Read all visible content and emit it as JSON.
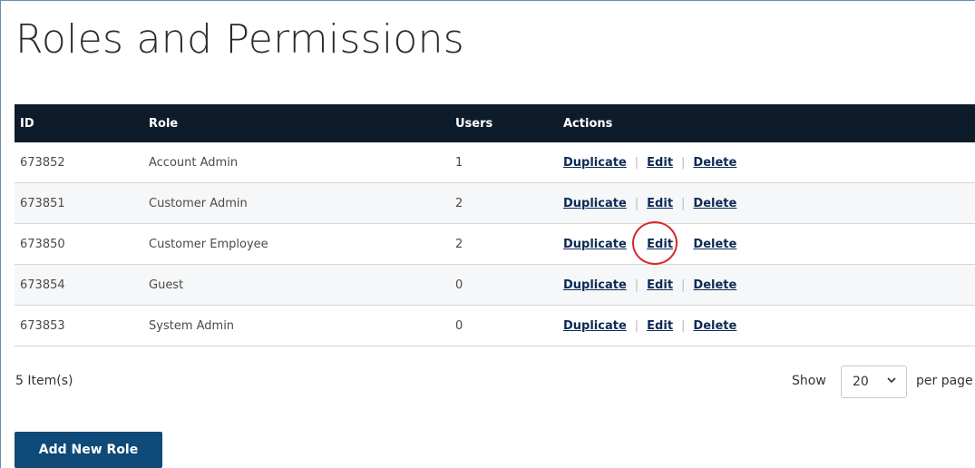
{
  "page": {
    "title": "Roles and Permissions"
  },
  "table": {
    "headers": {
      "id": "ID",
      "role": "Role",
      "users": "Users",
      "actions": "Actions"
    },
    "rows": [
      {
        "id": "673852",
        "role": "Account Admin",
        "users": "1"
      },
      {
        "id": "673851",
        "role": "Customer Admin",
        "users": "2"
      },
      {
        "id": "673850",
        "role": "Customer Employee",
        "users": "2"
      },
      {
        "id": "673854",
        "role": "Guest",
        "users": "0"
      },
      {
        "id": "673853",
        "role": "System Admin",
        "users": "0"
      }
    ],
    "actions": {
      "duplicate": "Duplicate",
      "edit": "Edit",
      "delete": "Delete",
      "separator": "|"
    }
  },
  "footer": {
    "item_count": "5 Item(s)",
    "show_label": "Show",
    "per_page_value": "20",
    "per_page_label": "per page",
    "add_button": "Add New Role"
  },
  "colors": {
    "header_bg": "#0e1b2b",
    "button_bg": "#0f4a78",
    "link": "#0d2a55",
    "highlight_circle": "#d8262b"
  }
}
